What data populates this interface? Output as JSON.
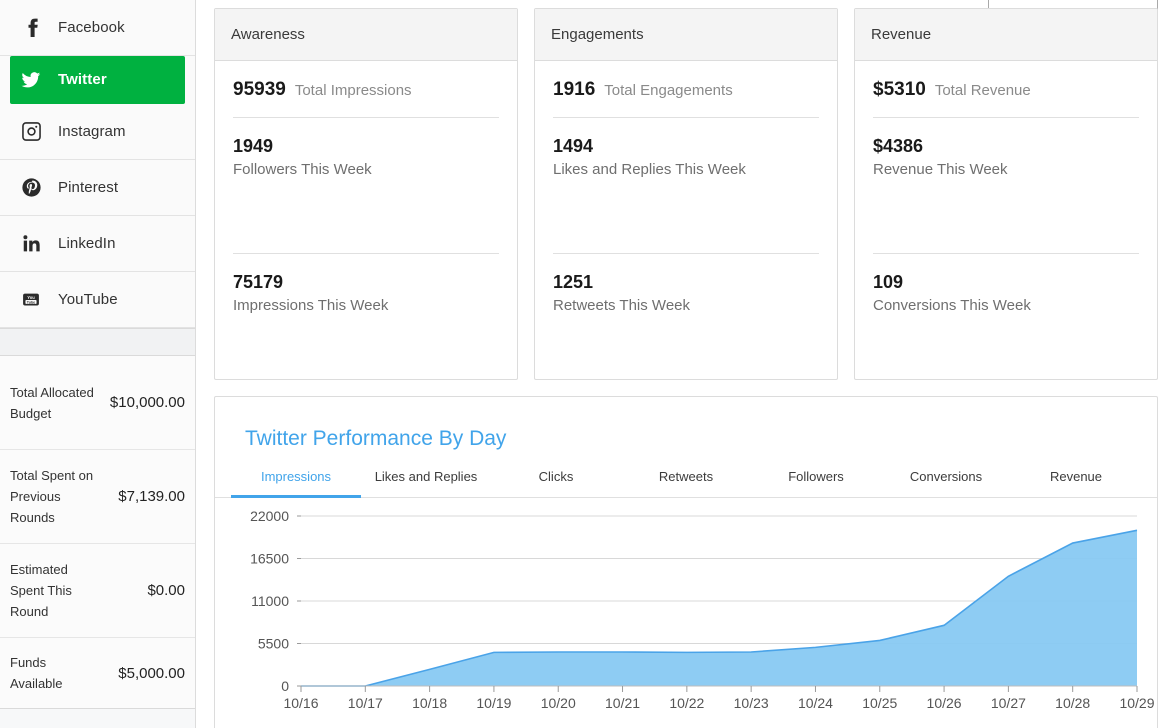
{
  "sidebar": {
    "channels": [
      {
        "name": "Facebook",
        "icon": "facebook-icon",
        "active": false
      },
      {
        "name": "Twitter",
        "icon": "twitter-icon",
        "active": true
      },
      {
        "name": "Instagram",
        "icon": "instagram-icon",
        "active": false
      },
      {
        "name": "Pinterest",
        "icon": "pinterest-icon",
        "active": false
      },
      {
        "name": "LinkedIn",
        "icon": "linkedin-icon",
        "active": false
      },
      {
        "name": "YouTube",
        "icon": "youtube-icon",
        "active": false
      }
    ],
    "budget": [
      {
        "label": "Total Allocated Budget",
        "value": "$10,000.00"
      },
      {
        "label": "Total Spent on Previous Rounds",
        "value": "$7,139.00"
      },
      {
        "label": "Estimated Spent This Round",
        "value": "$0.00"
      },
      {
        "label": "Funds Available",
        "value": "$5,000.00"
      }
    ]
  },
  "cards": [
    {
      "title": "Awareness",
      "total_value": "95939",
      "total_label": "Total Impressions",
      "second_value": "1949",
      "second_label": "Followers This Week",
      "third_value": "75179",
      "third_label": "Impressions This Week"
    },
    {
      "title": "Engagements",
      "total_value": "1916",
      "total_label": "Total Engagements",
      "second_value": "1494",
      "second_label": "Likes and Replies This Week",
      "third_value": "1251",
      "third_label": "Retweets This Week"
    },
    {
      "title": "Revenue",
      "total_value": "$5310",
      "total_label": "Total Revenue",
      "second_value": "$4386",
      "second_label": "Revenue This Week",
      "third_value": "109",
      "third_label": "Conversions This Week"
    }
  ],
  "chart_panel": {
    "title": "Twitter Performance By Day",
    "tabs": [
      {
        "label": "Impressions",
        "active": true
      },
      {
        "label": "Likes and Replies",
        "active": false
      },
      {
        "label": "Clicks",
        "active": false
      },
      {
        "label": "Retweets",
        "active": false
      },
      {
        "label": "Followers",
        "active": false
      },
      {
        "label": "Conversions",
        "active": false
      },
      {
        "label": "Revenue",
        "active": false
      }
    ]
  },
  "chart_data": {
    "type": "area",
    "title": "Twitter Performance By Day",
    "series_name": "Impressions",
    "xlabel": "",
    "ylabel": "",
    "grid": true,
    "legend": "none",
    "fill_color": "#88c9f2",
    "line_color": "#4aa3e8",
    "ylim": [
      0,
      22000
    ],
    "yticks": [
      0,
      5500,
      11000,
      16500,
      22000
    ],
    "ytick_labels": [
      "0",
      "5500",
      "11000",
      "16500",
      "22000"
    ],
    "categories": [
      "10/16",
      "10/17",
      "10/18",
      "10/19",
      "10/20",
      "10/21",
      "10/22",
      "10/23",
      "10/24",
      "10/25",
      "10/26",
      "10/27",
      "10/28",
      "10/29"
    ],
    "values": [
      0,
      0,
      2150,
      4350,
      4400,
      4400,
      4350,
      4400,
      5000,
      5900,
      7850,
      14200,
      18500,
      20150
    ]
  }
}
